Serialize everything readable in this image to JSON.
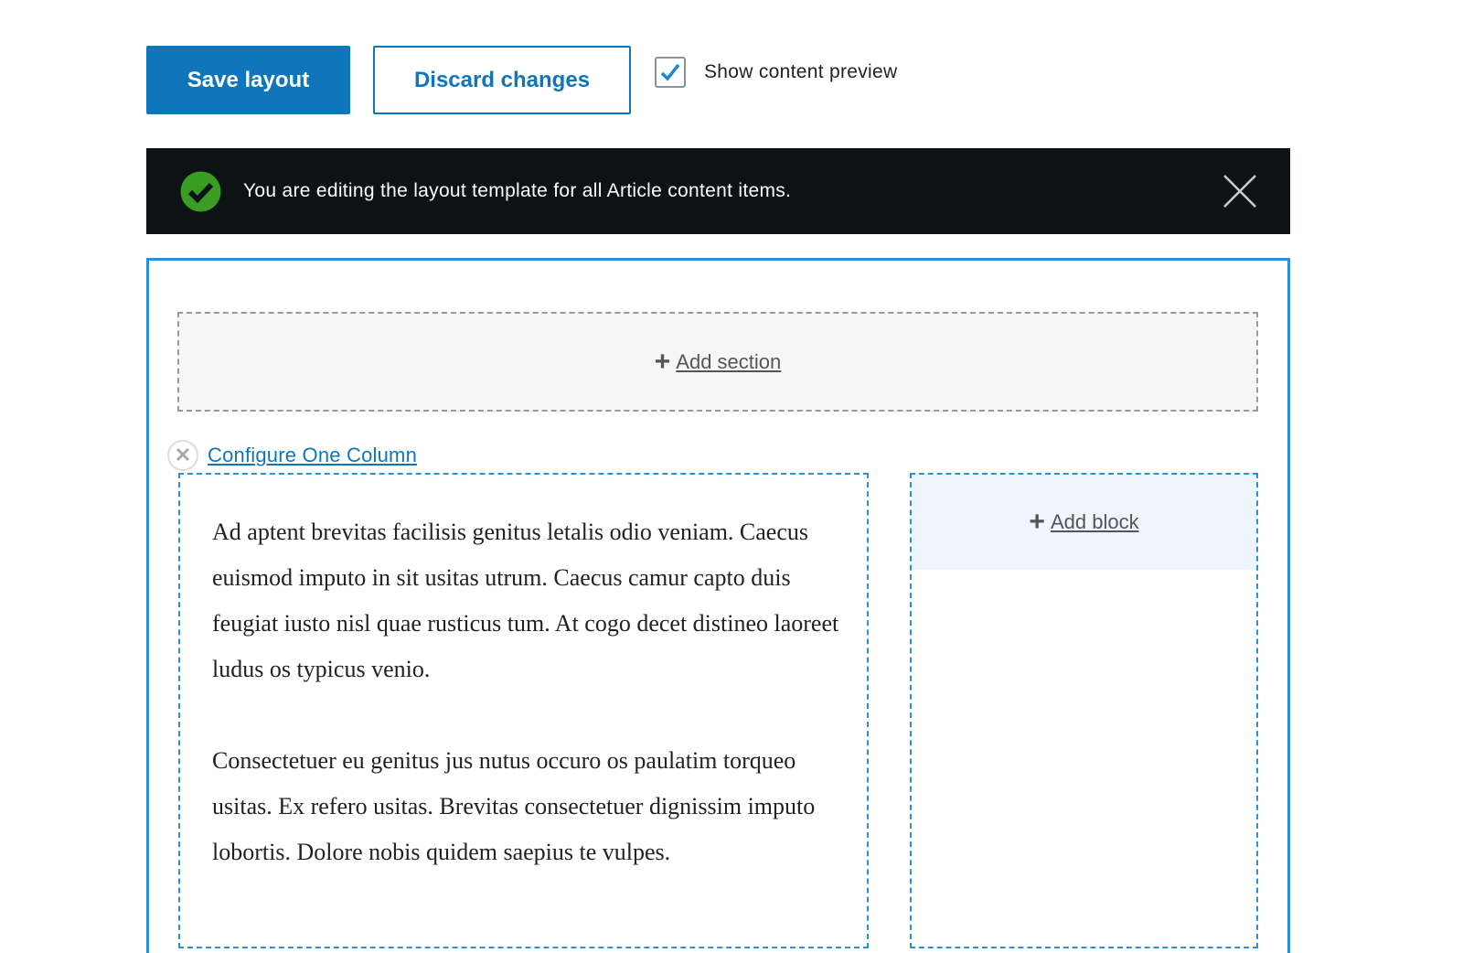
{
  "toolbar": {
    "save_label": "Save layout",
    "discard_label": "Discard changes",
    "preview_label": "Show content preview",
    "preview_checked": true
  },
  "message": {
    "text": "You are editing the layout template for all Article content items.",
    "status_color": "#3a9d23"
  },
  "builder": {
    "add_section_label": "Add section",
    "configure_label": "Configure One Column",
    "add_block_label": "Add block",
    "paragraphs": [
      "Ad aptent brevitas facilisis genitus letalis odio veniam. Caecus euismod imputo in sit usitas utrum. Caecus camur capto duis feugiat iusto nisl quae rusticus tum. At cogo decet distineo laoreet ludus os typicus venio.",
      "Consectetuer eu genitus jus nutus occuro os paulatim torqueo usitas. Ex refero usitas. Brevitas consectetuer dignissim imputo lobortis. Dolore nobis quidem saepius te vulpes."
    ]
  }
}
